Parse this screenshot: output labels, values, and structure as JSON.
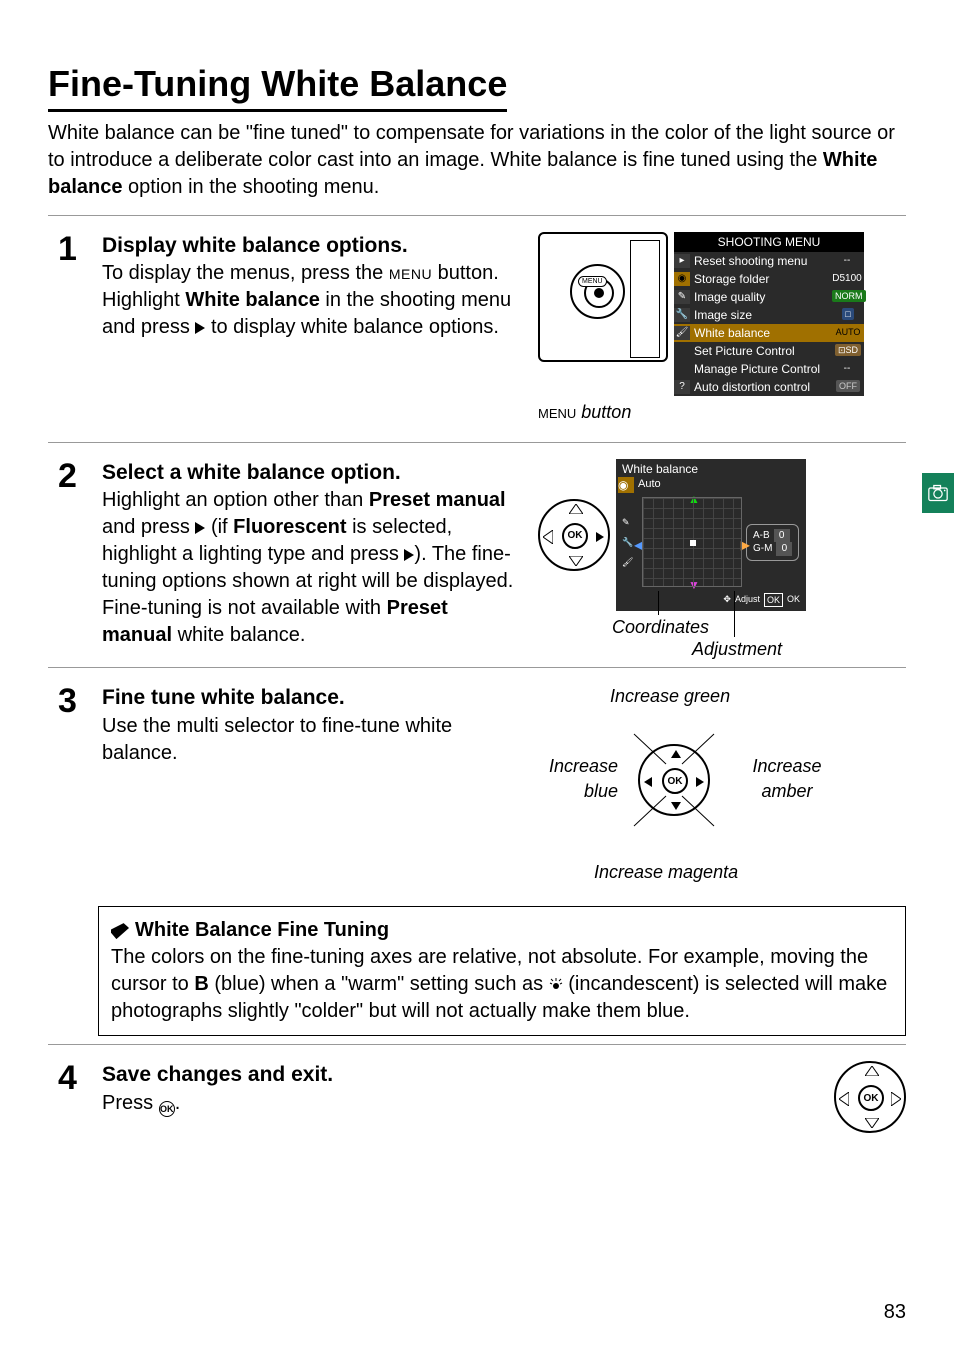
{
  "title": "Fine-Tuning White Balance",
  "intro_pre": "White balance can be \"fine tuned\" to compensate for variations in the color of the light source or to introduce a deliberate color cast into an image.  White balance is fine tuned using the ",
  "intro_bold": "White balance",
  "intro_post": " option in the shooting menu.",
  "step1": {
    "num": "1",
    "title": "Display white balance options.",
    "p1": "To display the menus, press the ",
    "menu_glyph": "MENU",
    "p2": " button. Highlight ",
    "bold1": "White balance",
    "p3": " in the shooting menu and press ",
    "p4": " to display white balance options.",
    "caption_pre": "MENU",
    "caption_post": " button"
  },
  "shooting_menu": {
    "title": "SHOOTING MENU",
    "items": [
      {
        "label": "Reset shooting menu",
        "val": "--"
      },
      {
        "label": "Storage folder",
        "val": "D5100"
      },
      {
        "label": "Image quality",
        "val": "NORM"
      },
      {
        "label": "Image size",
        "val": "□"
      },
      {
        "label": "White balance",
        "val": "AUTO"
      },
      {
        "label": "Set Picture Control",
        "val": "⊡SD"
      },
      {
        "label": "Manage Picture Control",
        "val": "--"
      },
      {
        "label": "Auto distortion control",
        "val": "OFF"
      }
    ]
  },
  "step2": {
    "num": "2",
    "title": "Select a white balance option.",
    "p1": "Highlight an option other than ",
    "bold1": "Preset manual",
    "p2": " and press ",
    "p3": " (if ",
    "bold2": "Fluorescent",
    "p4": " is selected, highlight a lighting type and press ",
    "p5": ").  The fine-tuning options shown at right will be displayed.  Fine-tuning is not available with ",
    "bold3": "Preset manual",
    "p6": " white balance.",
    "wb_title": "White balance",
    "wb_sub": "Auto",
    "ab": "A-B",
    "ab_v": "0",
    "gm": "G-M",
    "gm_v": "0",
    "adjust": "Adjust",
    "ok": "OK",
    "coord": "Coordinates",
    "adj": "Adjustment"
  },
  "step3": {
    "num": "3",
    "title": "Fine tune white balance.",
    "body": "Use the multi selector to fine-tune white balance.",
    "top": "Increase green",
    "bot": "Increase magenta",
    "left1": "Increase",
    "left2": "blue",
    "right1": "Increase",
    "right2": "amber",
    "ok": "OK"
  },
  "note": {
    "title": "White Balance Fine Tuning",
    "p1": "The colors on the fine-tuning axes are relative, not absolute.  For example, moving the cursor to ",
    "b1": "B",
    "p2": " (blue) when a \"warm\" setting such as ",
    "p3": " (incandescent) is selected will make photographs slightly \"colder\" but will not actually make them blue."
  },
  "step4": {
    "num": "4",
    "title": "Save changes and exit.",
    "p1": "Press ",
    "p2": ".",
    "ok": "OK"
  },
  "page": "83"
}
